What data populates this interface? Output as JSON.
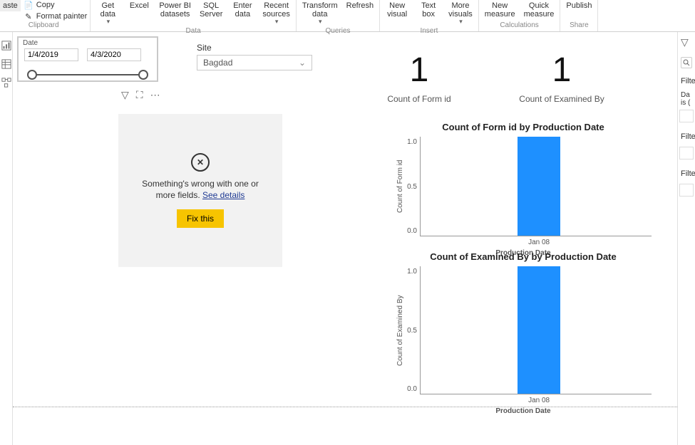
{
  "ribbon": {
    "clipboard": {
      "copy": "Copy",
      "format_painter": "Format painter",
      "group_label": "Clipboard"
    },
    "data": {
      "paste": "aste",
      "get_data": "Get\ndata",
      "excel": "Excel",
      "pbi_datasets": "Power BI\ndatasets",
      "sql_server": "SQL\nServer",
      "enter_data": "Enter\ndata",
      "recent_sources": "Recent\nsources",
      "group_label": "Data"
    },
    "queries": {
      "transform": "Transform\ndata",
      "refresh": "Refresh",
      "group_label": "Queries"
    },
    "insert": {
      "new_visual": "New\nvisual",
      "text_box": "Text\nbox",
      "more_visuals": "More\nvisuals",
      "group_label": "Insert"
    },
    "calculations": {
      "new_measure": "New\nmeasure",
      "quick_measure": "Quick\nmeasure",
      "group_label": "Calculations"
    },
    "share": {
      "publish": "Publish",
      "group_label": "Share"
    }
  },
  "slicer": {
    "header": "Date",
    "from": "1/4/2019",
    "to": "4/3/2020"
  },
  "site": {
    "label": "Site",
    "selected": "Bagdad"
  },
  "card1": {
    "value": "1",
    "label": "Count of Form id"
  },
  "card2": {
    "value": "1",
    "label": "Count of Examined By"
  },
  "error": {
    "msg1": "Something's wrong with one or more fields.",
    "link": "See details",
    "btn": "Fix this"
  },
  "chart1_title": "Count of Form id by Production Date",
  "chart2_title": "Count of Examined By by Production Date",
  "y_label_1": "Count of Form id",
  "y_label_2": "Count of Examined By",
  "x_label": "Production Date",
  "x_tick": "Jan 08",
  "y_ticks": [
    "1.0",
    "0.5",
    "0.0"
  ],
  "rightpane": {
    "filters_label": "Filte",
    "da": "Da",
    "is": "is (",
    "filter2": "Filte",
    "filter3": "Filte"
  },
  "chart_data": [
    {
      "type": "bar",
      "title": "Count of Form id by Production Date",
      "categories": [
        "Jan 08"
      ],
      "values": [
        1.0
      ],
      "xlabel": "Production Date",
      "ylabel": "Count of Form id",
      "ylim": [
        0.0,
        1.0
      ]
    },
    {
      "type": "bar",
      "title": "Count of Examined By by Production Date",
      "categories": [
        "Jan 08"
      ],
      "values": [
        1.0
      ],
      "xlabel": "Production Date",
      "ylabel": "Count of Examined By",
      "ylim": [
        0.0,
        1.0
      ]
    }
  ]
}
